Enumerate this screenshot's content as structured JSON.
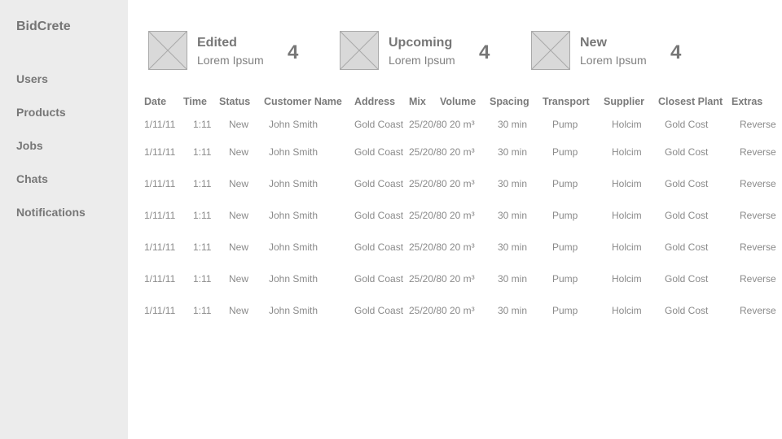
{
  "app": {
    "title": "BidCrete"
  },
  "sidebar": {
    "items": [
      {
        "label": "Users"
      },
      {
        "label": "Products"
      },
      {
        "label": "Jobs"
      },
      {
        "label": "Chats"
      },
      {
        "label": "Notifications"
      }
    ]
  },
  "stats": [
    {
      "title": "Edited",
      "subtitle": "Lorem Ipsum",
      "count": "4",
      "icon": "image-placeholder-icon"
    },
    {
      "title": "Upcoming",
      "subtitle": "Lorem Ipsum",
      "count": "4",
      "icon": "image-placeholder-icon"
    },
    {
      "title": "New",
      "subtitle": "Lorem Ipsum",
      "count": "4",
      "icon": "image-placeholder-icon"
    }
  ],
  "table": {
    "headers": [
      "Date",
      "Time",
      "Status",
      "Customer Name",
      "Address",
      "Mix",
      "Volume",
      "Spacing",
      "Transport",
      "Supplier",
      "Closest Plant",
      "Extras"
    ],
    "rows": [
      [
        "1/11/11",
        "1:11",
        "New",
        "John Smith",
        "Gold Coast",
        "25/20/80",
        "20 m³",
        "30 min",
        "Pump",
        "Holcim",
        "Gold Cost",
        "Reverse"
      ],
      [
        "1/11/11",
        "1:11",
        "New",
        "John Smith",
        "Gold Coast",
        "25/20/80",
        "20 m³",
        "30 min",
        "Pump",
        "Holcim",
        "Gold Cost",
        "Reverse"
      ],
      [
        "1/11/11",
        "1:11",
        "New",
        "John Smith",
        "Gold Coast",
        "25/20/80",
        "20 m³",
        "30 min",
        "Pump",
        "Holcim",
        "Gold Cost",
        "Reverse"
      ],
      [
        "1/11/11",
        "1:11",
        "New",
        "John Smith",
        "Gold Coast",
        "25/20/80",
        "20 m³",
        "30 min",
        "Pump",
        "Holcim",
        "Gold Cost",
        "Reverse"
      ],
      [
        "1/11/11",
        "1:11",
        "New",
        "John Smith",
        "Gold Coast",
        "25/20/80",
        "20 m³",
        "30 min",
        "Pump",
        "Holcim",
        "Gold Cost",
        "Reverse"
      ],
      [
        "1/11/11",
        "1:11",
        "New",
        "John Smith",
        "Gold Coast",
        "25/20/80",
        "20 m³",
        "30 min",
        "Pump",
        "Holcim",
        "Gold Cost",
        "Reverse"
      ],
      [
        "1/11/11",
        "1:11",
        "New",
        "John Smith",
        "Gold Coast",
        "25/20/80",
        "20 m³",
        "30 min",
        "Pump",
        "Holcim",
        "Gold Cost",
        "Reverse"
      ]
    ]
  }
}
